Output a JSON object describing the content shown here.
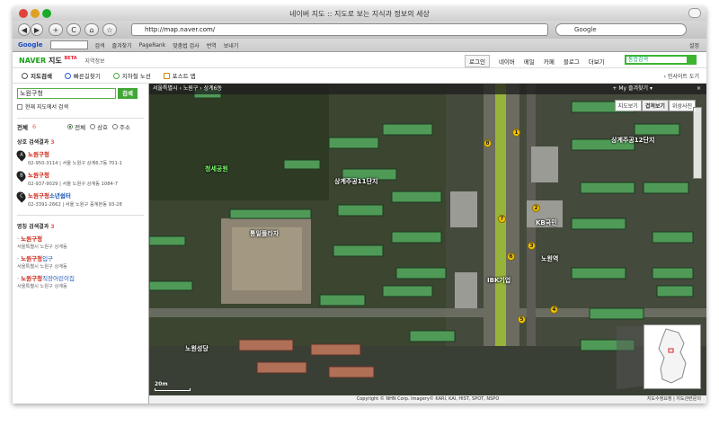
{
  "window": {
    "title": "네이버 지도 :: 지도로 보는 지식과 정보의 세상"
  },
  "browser": {
    "back": "◀",
    "forward": "▶",
    "plus": "+",
    "reload": "C",
    "url": "http://map.naver.com/",
    "search_placeholder": "Google"
  },
  "google_bar": {
    "logo": "Google",
    "items": [
      "검색",
      "즐겨찾기",
      "PageRank",
      "맞춤법 검사",
      "번역",
      "보내기"
    ],
    "settings": "설정"
  },
  "naver": {
    "logo": "NAVER",
    "logo_map": "지도",
    "beta": "BETA",
    "region": "지역정보",
    "login": "로그인",
    "nav": [
      "네이버",
      "메일",
      "카페",
      "블로그",
      "더보기"
    ],
    "search_placeholder": "통합검색"
  },
  "menu": {
    "items": [
      "지도검색",
      "빠른길찾기",
      "지하철 노선",
      "포스트 맵"
    ],
    "help": "› 인사이트 도기"
  },
  "sidebar": {
    "query": "노원구청",
    "search_button": "검색",
    "checkbox_label": "현재 지도에서 검색",
    "filter_label": "전체",
    "filter_count": "6",
    "radios": [
      "전체",
      "상호",
      "주소"
    ],
    "section1": {
      "title": "상호 검색결과",
      "count": "3"
    },
    "places": [
      {
        "pin": "A",
        "name_hl": "노원구청",
        "name_rest": "",
        "address": "02-950-3114 | 서울 노원구 상계6,7동 701-1"
      },
      {
        "pin": "B",
        "name_hl": "노원구청",
        "name_rest": "",
        "address": "02-937-9029 | 서울 노원구 상계동 1084-7"
      },
      {
        "pin": "C",
        "name_hl": "노원구청",
        "name_rest": "소년쉼터",
        "address": "02-3391-2662 | 서울 노원구 중계본동 93-28"
      }
    ],
    "section2": {
      "title": "명칭 검색결과",
      "count": "3"
    },
    "names": [
      {
        "hl": "노원구청",
        "rest": "",
        "address": "서울특별시 노원구 상계동"
      },
      {
        "hl": "노원구청",
        "rest": "입구",
        "address": "서울특별시 노원구 상계동"
      },
      {
        "hl": "노원구청",
        "rest": "직장어린이집",
        "address": "서울특별시 노원구 상계동"
      }
    ]
  },
  "map": {
    "breadcrumb": "서울특별시 › 노원구 › 상계6동",
    "favorite": "+ My 즐겨찾기 ▾",
    "close": "×",
    "tabs": [
      "지도보기",
      "겹쳐보기",
      "위성사진"
    ],
    "active_tab": "겹쳐보기",
    "labels": {
      "apt1": "상계주공11단지",
      "apt2": "상계주공12단지",
      "park": "청세공원",
      "mall": "통일플라자",
      "church": "노원성당",
      "bank1": "KB국민",
      "bank2": "IBK기업",
      "station": "노원역"
    },
    "numbers": [
      "1",
      "2",
      "3",
      "4",
      "5",
      "6",
      "7",
      "8"
    ],
    "scale": "20m",
    "copyright": "Copyright © NHN Corp. Imagery© KARI, KAI, HIST, SPOT, NSPO",
    "feedback": "지도수정요청 | 지도관련문의"
  }
}
